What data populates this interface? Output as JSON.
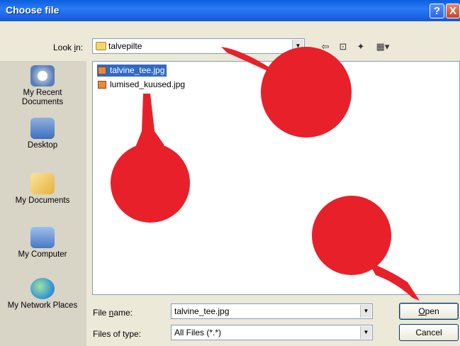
{
  "window": {
    "title": "Choose file",
    "help_glyph": "?",
    "close_glyph": "X"
  },
  "look_in": {
    "label_prefix": "Look ",
    "label_key": "i",
    "label_suffix": "n:",
    "value": "talvepilte",
    "folder_icon": "folder-icon"
  },
  "toolbar": {
    "back": "⇦",
    "up": "⊡",
    "new_folder": "✦",
    "views": "▦▾"
  },
  "places": [
    {
      "label": "My Recent Documents",
      "icon": "recent-documents-icon"
    },
    {
      "label": "Desktop",
      "icon": "desktop-icon"
    },
    {
      "label": "My Documents",
      "icon": "my-documents-icon"
    },
    {
      "label": "My Computer",
      "icon": "my-computer-icon"
    },
    {
      "label": "My Network Places",
      "icon": "network-places-icon"
    }
  ],
  "files": [
    {
      "name": "talvine_tee.jpg",
      "selected": true
    },
    {
      "name": "lumised_kuused.jpg",
      "selected": false
    }
  ],
  "file_name": {
    "label_prefix": "File ",
    "label_key": "n",
    "label_suffix": "ame:",
    "value": "talvine_tee.jpg"
  },
  "file_type": {
    "label": "Files of type:",
    "value": "All Files (*.*)"
  },
  "buttons": {
    "open_key": "O",
    "open_rest": "pen",
    "cancel": "Cancel"
  },
  "colors": {
    "titlebar": "#0a5fe0",
    "selection": "#316ac5",
    "annotation": "#e8202a"
  }
}
